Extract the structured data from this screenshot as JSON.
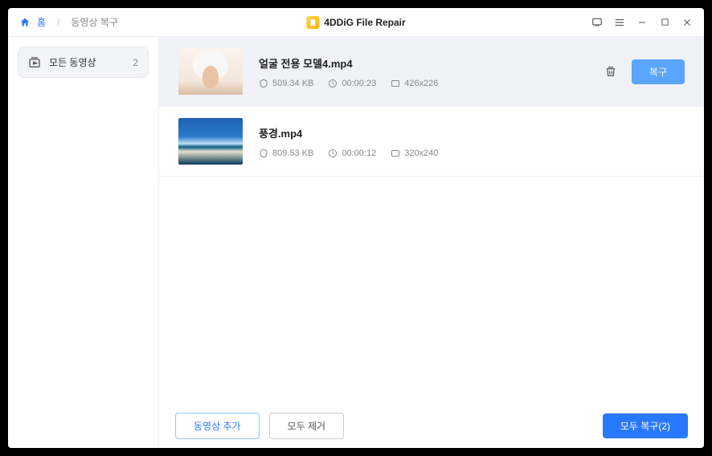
{
  "titlebar": {
    "home_label": "홈",
    "breadcrumb_current": "동영상 복구",
    "app_title": "4DDiG File Repair"
  },
  "sidebar": {
    "items": [
      {
        "label": "모든 동영상",
        "count": "2"
      }
    ]
  },
  "files": [
    {
      "name": "얼굴 전용 모델4.mp4",
      "size": "509.34 KB",
      "duration": "00:00:23",
      "dimensions": "426x226",
      "selected": true,
      "repair_label": "복구"
    },
    {
      "name": "풍경.mp4",
      "size": "809.53 KB",
      "duration": "00:00:12",
      "dimensions": "320x240",
      "selected": false
    }
  ],
  "footer": {
    "add_video_label": "동영상 추가",
    "remove_all_label": "모두 제거",
    "repair_all_label": "모두 복구(2)"
  }
}
